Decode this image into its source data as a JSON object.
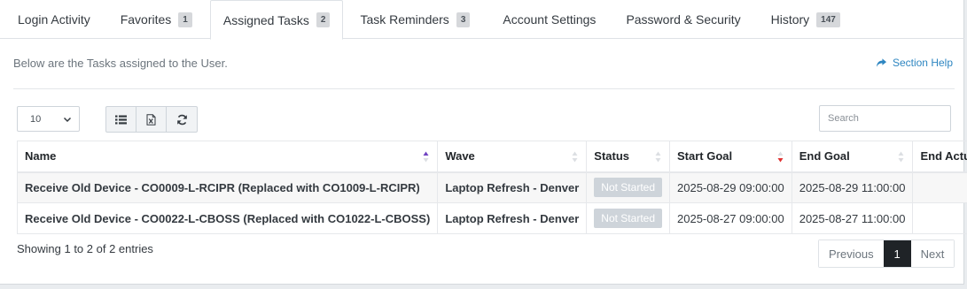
{
  "tabs": [
    {
      "label": "Login Activity",
      "badge": ""
    },
    {
      "label": "Favorites",
      "badge": "1"
    },
    {
      "label": "Assigned Tasks",
      "badge": "2"
    },
    {
      "label": "Task Reminders",
      "badge": "3"
    },
    {
      "label": "Account Settings",
      "badge": ""
    },
    {
      "label": "Password & Security",
      "badge": ""
    },
    {
      "label": "History",
      "badge": "147"
    }
  ],
  "intro_text": "Below are the Tasks assigned to the User.",
  "help_label": "Section Help",
  "page_length": "10",
  "search": {
    "placeholder": "Search",
    "value": ""
  },
  "table": {
    "columns": [
      "Name",
      "Wave",
      "Status",
      "Start Goal",
      "End Goal",
      "End Actual"
    ],
    "rows": [
      {
        "name": "Receive Old Device - CO0009-L-RCIPR (Replaced with CO1009-L-RCIPR)",
        "wave": "Laptop Refresh - Denver",
        "status": "Not Started",
        "start_goal": "2025-08-29 09:00:00",
        "end_goal": "2025-08-29 11:00:00",
        "end_actual": ""
      },
      {
        "name": "Receive Old Device - CO0022-L-CBOSS (Replaced with CO1022-L-CBOSS)",
        "wave": "Laptop Refresh - Denver",
        "status": "Not Started",
        "start_goal": "2025-08-27 09:00:00",
        "end_goal": "2025-08-27 11:00:00",
        "end_actual": ""
      }
    ]
  },
  "info_text": "Showing 1 to 2 of 2 entries",
  "pagination": {
    "previous": "Previous",
    "current": "1",
    "next": "Next"
  },
  "colors": {
    "accent": "#2e86c1",
    "sort_up_active": "#6f42c1",
    "sort_down_active": "#e03131",
    "status_pill": "#ced4da"
  }
}
